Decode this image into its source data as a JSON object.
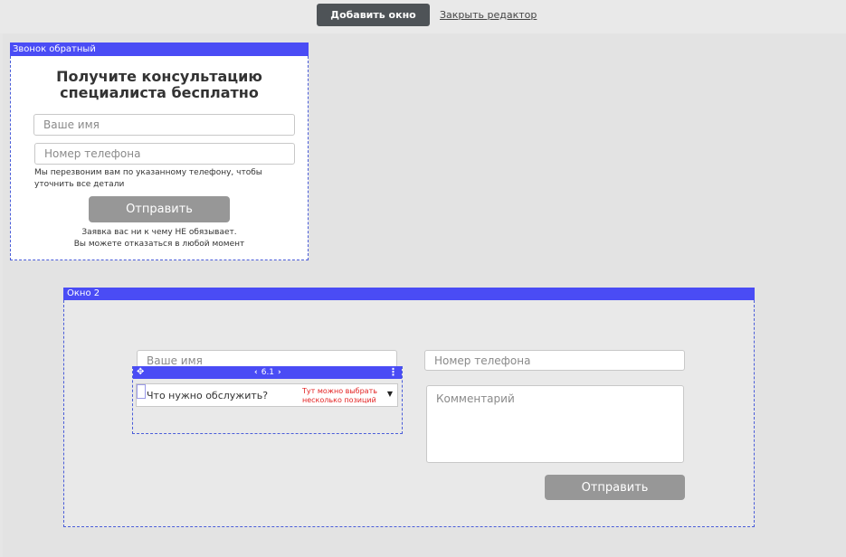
{
  "toolbar": {
    "add_window_label": "Добавить окно",
    "close_editor_label": "Закрыть редактор"
  },
  "window1": {
    "header": "Звонок обратный",
    "title_line1": "Получите консультацию",
    "title_line2": "специалиста бесплатно",
    "name_placeholder": "Ваше имя",
    "phone_placeholder": "Номер телефона",
    "note": "Мы перезвоним вам по указанному телефону, чтобы уточнить все детали",
    "submit_label": "Отправить",
    "footer_line1": "Заявка вас ни к чему НЕ обязывает.",
    "footer_line2": "Вы можете отказаться в любой момент"
  },
  "window2": {
    "header": "Окно 2",
    "name_placeholder": "Ваше имя",
    "phone_placeholder": "Номер телефона",
    "selection_toolbar": {
      "move_icon": "move-icon",
      "position_label": "6.1",
      "menu_icon": "vertical-dots-icon"
    },
    "service_select": {
      "label": "Что нужно обслужить?",
      "hint_line1": "Тут можно выбрать",
      "hint_line2": "несколько позиций"
    },
    "comment_placeholder": "Комментарий",
    "submit_label": "Отправить"
  },
  "colors": {
    "accent": "#4a4cf5",
    "dark_button": "#4e5357",
    "grey_button": "#979797",
    "hint_red": "#e32222"
  }
}
